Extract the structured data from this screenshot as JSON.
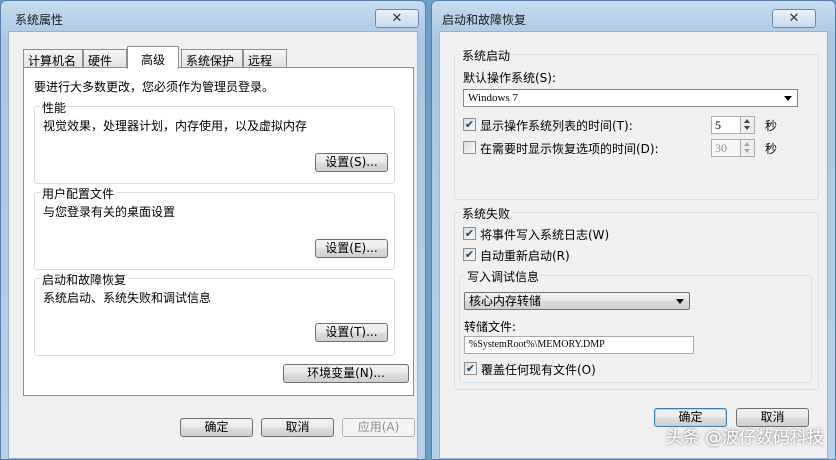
{
  "left_window": {
    "title": "系统属性",
    "close": "✕",
    "tabs": [
      "计算机名",
      "硬件",
      "高级",
      "系统保护",
      "远程"
    ],
    "admin_note": "要进行大多数更改，您必须作为管理员登录。",
    "performance": {
      "label": "性能",
      "desc": "视觉效果，处理器计划，内存使用，以及虚拟内存",
      "button": "设置(S)..."
    },
    "user_profiles": {
      "label": "用户配置文件",
      "desc": "与您登录有关的桌面设置",
      "button": "设置(E)..."
    },
    "startup_recovery": {
      "label": "启动和故障恢复",
      "desc": "系统启动、系统失败和调试信息",
      "button": "设置(T)..."
    },
    "env_button": "环境变量(N)...",
    "ok": "确定",
    "cancel": "取消",
    "apply": "应用(A)"
  },
  "right_window": {
    "title": "启动和故障恢复",
    "close": "✕",
    "system_startup": {
      "label": "系统启动",
      "default_os_label": "默认操作系统(S):",
      "default_os_value": "Windows 7",
      "show_list_label": "显示操作系统列表的时间(T):",
      "show_list_checked": true,
      "show_list_value": "5",
      "show_recovery_label": "在需要时显示恢复选项的时间(D):",
      "show_recovery_checked": false,
      "show_recovery_value": "30",
      "seconds": "秒"
    },
    "system_failure": {
      "label": "系统失败",
      "write_event_label": "将事件写入系统日志(W)",
      "write_event_checked": true,
      "auto_restart_label": "自动重新启动(R)",
      "auto_restart_checked": true,
      "debug_info_label": "写入调试信息",
      "debug_type": "核心内存转储",
      "dump_file_label": "转储文件:",
      "dump_file_value": "%SystemRoot%\\MEMORY.DMP",
      "overwrite_label": "覆盖任何现有文件(O)",
      "overwrite_checked": true
    },
    "ok": "确定",
    "cancel": "取消"
  },
  "watermark": "头条 @波仔数码科技",
  "colors": {
    "desktop": "#6b9fc7",
    "client_bg": "#f0f0f0",
    "frame": "#b9d1e8",
    "check": "#20466b"
  }
}
